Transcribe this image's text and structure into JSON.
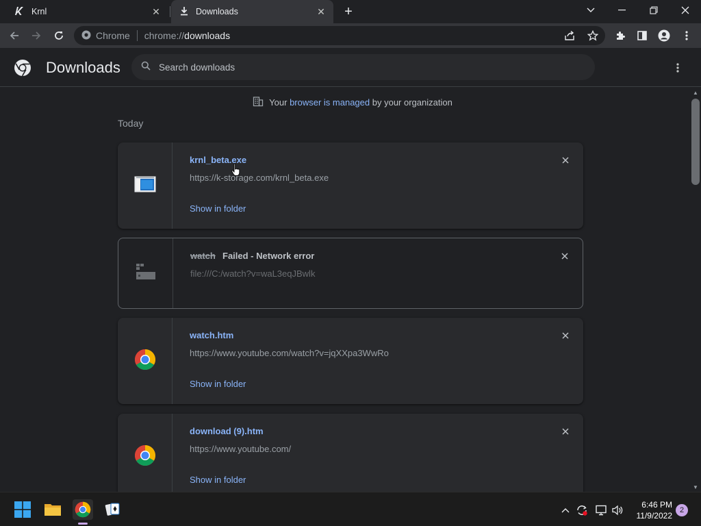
{
  "tabs": [
    {
      "title": "Krnl",
      "icon": "krnl-k-icon"
    },
    {
      "title": "Downloads",
      "icon": "download-arrow-icon",
      "active": true
    }
  ],
  "toolbar": {
    "site_label": "Chrome",
    "url_prefix": "chrome://",
    "url_host": "downloads"
  },
  "page": {
    "title": "Downloads",
    "search_placeholder": "Search downloads"
  },
  "managed": {
    "pre": "Your",
    "link": "browser is managed",
    "post": "by your organization"
  },
  "section": "Today",
  "downloads": [
    {
      "name": "krnl_beta.exe",
      "url": "https://k-storage.com/krnl_beta.exe",
      "action": "Show in folder",
      "icon": "exe-window-icon"
    },
    {
      "name": "watch",
      "status": "Failed - Network error",
      "url": "file:///C:/watch?v=waL3eqJBwlk",
      "icon": "generic-file-icon"
    },
    {
      "name": "watch.htm",
      "url": "https://www.youtube.com/watch?v=jqXXpa3WwRo",
      "action": "Show in folder",
      "icon": "chrome-logo-icon"
    },
    {
      "name": "download (9).htm",
      "url": "https://www.youtube.com/",
      "action": "Show in folder",
      "icon": "chrome-logo-icon"
    }
  ],
  "taskbar": {
    "time": "6:46 PM",
    "date": "11/9/2022",
    "notifications": "2"
  },
  "colors": {
    "link": "#8ab4f8",
    "background": "#202124",
    "card": "#292a2d",
    "toolbar": "#35363a"
  }
}
